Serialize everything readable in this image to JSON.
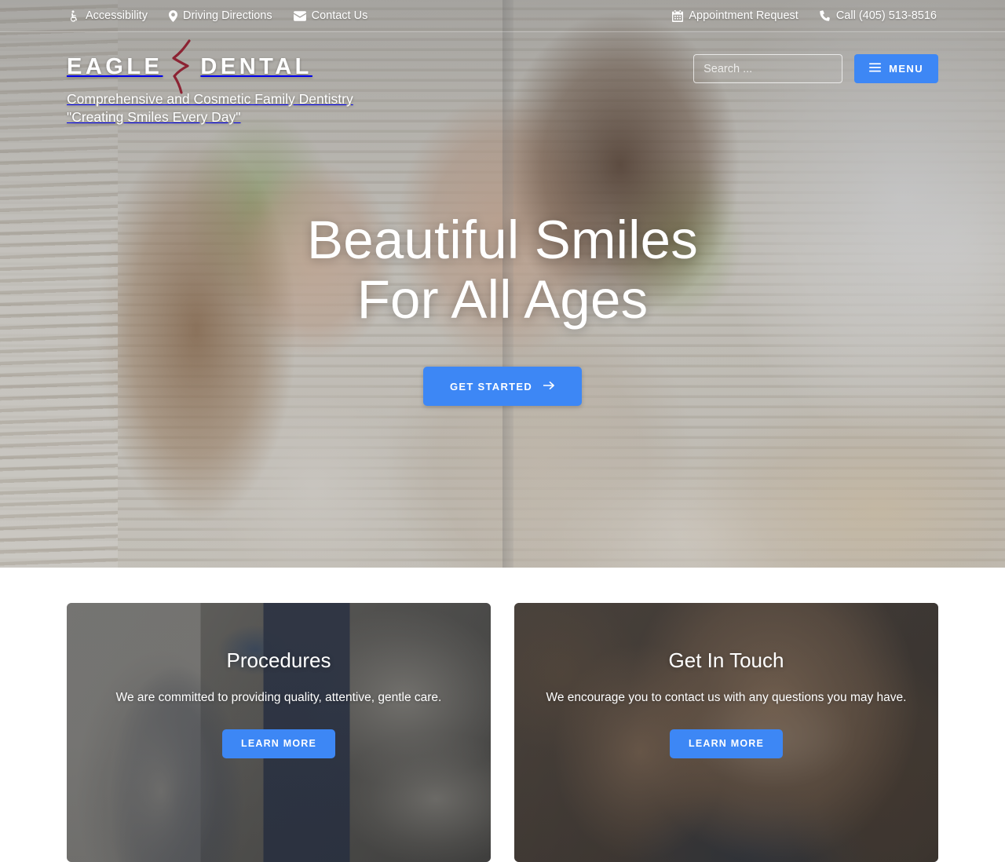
{
  "topbar": {
    "left_links": [
      {
        "label": "Accessibility",
        "icon": "wheelchair-icon"
      },
      {
        "label": "Driving Directions",
        "icon": "map-pin-icon"
      },
      {
        "label": "Contact Us",
        "icon": "envelope-icon"
      }
    ],
    "right_links": [
      {
        "label": "Appointment Request",
        "icon": "calendar-icon"
      },
      {
        "label": "Call (405) 513-8516",
        "icon": "phone-icon"
      }
    ]
  },
  "brand": {
    "word_one": "EAGLE",
    "word_two": "DENTAL",
    "tagline_line1": "Comprehensive and Cosmetic Family Dentistry",
    "tagline_line2": "\"Creating Smiles Every Day\"",
    "mark_color": "#8c2333"
  },
  "search": {
    "placeholder": "Search ...",
    "value": ""
  },
  "menu": {
    "label": "MENU"
  },
  "hero": {
    "title_line1": "Beautiful Smiles",
    "title_line2": "For All Ages",
    "cta_label": "GET STARTED"
  },
  "cards": [
    {
      "title": "Procedures",
      "text": "We are committed to providing quality, attentive, gentle care.",
      "button_label": "LEARN MORE"
    },
    {
      "title": "Get In Touch",
      "text": "We encourage you to contact us with any questions you may have.",
      "button_label": "LEARN MORE"
    }
  ],
  "colors": {
    "accent_blue": "#3d87f5",
    "logo_red": "#8c2333",
    "text_white": "#ffffff"
  }
}
